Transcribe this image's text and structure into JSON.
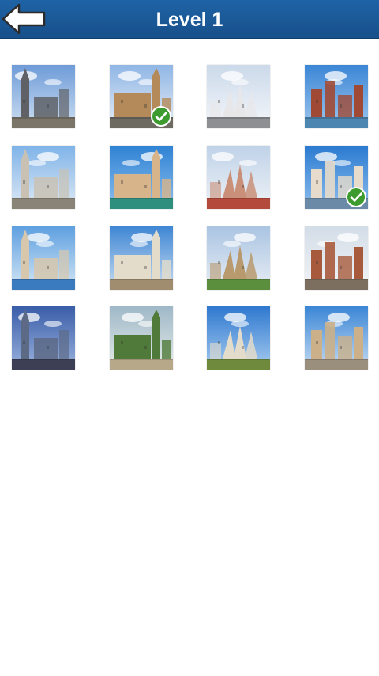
{
  "header": {
    "title": "Level 1",
    "back_icon": "back-arrow-icon",
    "color": "#1b5a99"
  },
  "level": {
    "photos": [
      {
        "name": "equestrian-statue-tower",
        "solved": false
      },
      {
        "name": "parliament-clock-tower",
        "solved": true
      },
      {
        "name": "crown-cathedral",
        "solved": false
      },
      {
        "name": "twin-tower-harbor",
        "solved": false
      },
      {
        "name": "skyscraper-skyline",
        "solved": false
      },
      {
        "name": "river-old-town",
        "solved": false
      },
      {
        "name": "arched-bridge-canal",
        "solved": false
      },
      {
        "name": "riverside-fortress-tower",
        "solved": true
      },
      {
        "name": "coastal-harbor-city",
        "solved": false
      },
      {
        "name": "domed-capitol",
        "solved": false
      },
      {
        "name": "formal-gardens-palace",
        "solved": false
      },
      {
        "name": "gothic-spires-square",
        "solved": false
      },
      {
        "name": "downtown-towers",
        "solved": false
      },
      {
        "name": "park-statue",
        "solved": false
      },
      {
        "name": "cathedral-leaning-tower",
        "solved": false
      },
      {
        "name": "baroque-church-square",
        "solved": false
      }
    ],
    "solved_icon": "checkmark-icon",
    "solved_color": "#3c9a2e"
  }
}
